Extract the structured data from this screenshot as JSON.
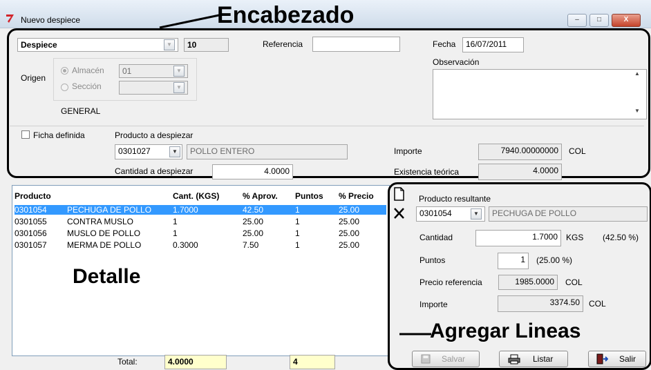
{
  "window": {
    "title": "Nuevo despiece",
    "min": "–",
    "max": "□",
    "close": "X"
  },
  "annotations": {
    "header": "Encabezado",
    "detail": "Detalle",
    "add_lines": "Agregar Lineas"
  },
  "header": {
    "doc_type": "Despiece",
    "doc_number": "10",
    "referencia_label": "Referencia",
    "referencia_value": "",
    "fecha_label": "Fecha",
    "fecha_value": "16/07/2011",
    "observacion_label": "Observación",
    "observacion_value": "",
    "origen_label": "Origen",
    "almacen_label": "Almacén",
    "almacen_value": "01",
    "seccion_label": "Sección",
    "seccion_value": "",
    "general_label": "GENERAL",
    "ficha_definida_label": "Ficha definida",
    "producto_despiezar_label": "Producto a despiezar",
    "producto_code": "0301027",
    "producto_name": "POLLO ENTERO",
    "cantidad_label": "Cantidad a despiezar",
    "cantidad_value": "4.0000",
    "importe_label": "Importe",
    "importe_value": "7940.00000000",
    "importe_currency": "COL",
    "existencia_label": "Existencia teórica",
    "existencia_value": "4.0000"
  },
  "grid": {
    "columns": [
      "Producto",
      "Cant. (KGS)",
      "% Aprov.",
      "Puntos",
      "% Precio"
    ],
    "rows": [
      {
        "code": "0301054",
        "name": "PECHUGA DE POLLO",
        "cant": "1.7000",
        "aprov": "42.50",
        "puntos": "1",
        "precio": "25.00"
      },
      {
        "code": "0301055",
        "name": "CONTRA MUSLO",
        "cant": "1",
        "aprov": "25.00",
        "puntos": "1",
        "precio": "25.00"
      },
      {
        "code": "0301056",
        "name": "MUSLO DE POLLO",
        "cant": "1",
        "aprov": "25.00",
        "puntos": "1",
        "precio": "25.00"
      },
      {
        "code": "0301057",
        "name": "MERMA DE POLLO",
        "cant": "0.3000",
        "aprov": "7.50",
        "puntos": "1",
        "precio": "25.00"
      }
    ],
    "total_label": "Total:",
    "total_cant": "4.0000",
    "total_puntos": "4"
  },
  "line": {
    "producto_resultante_label": "Producto resultante",
    "code": "0301054",
    "name": "PECHUGA DE POLLO",
    "cantidad_label": "Cantidad",
    "cantidad_value": "1.7000",
    "cantidad_unit": "KGS",
    "cantidad_pct": "(42.50 %)",
    "puntos_label": "Puntos",
    "puntos_value": "1",
    "puntos_pct": "(25.00 %)",
    "precio_ref_label": "Precio referencia",
    "precio_ref_value": "1985.0000",
    "precio_ref_currency": "COL",
    "importe_label": "Importe",
    "importe_value": "3374.50",
    "importe_currency": "COL"
  },
  "buttons": {
    "salvar": "Salvar",
    "listar": "Listar",
    "salir": "Salir"
  },
  "icons": [
    "app-logo-icon",
    "new-line-icon",
    "delete-line-icon",
    "save-icon",
    "printer-icon",
    "exit-door-icon"
  ],
  "colors": {
    "selection": "#3399ff",
    "total_bg": "#ffffcc",
    "annotation": "#000000"
  }
}
